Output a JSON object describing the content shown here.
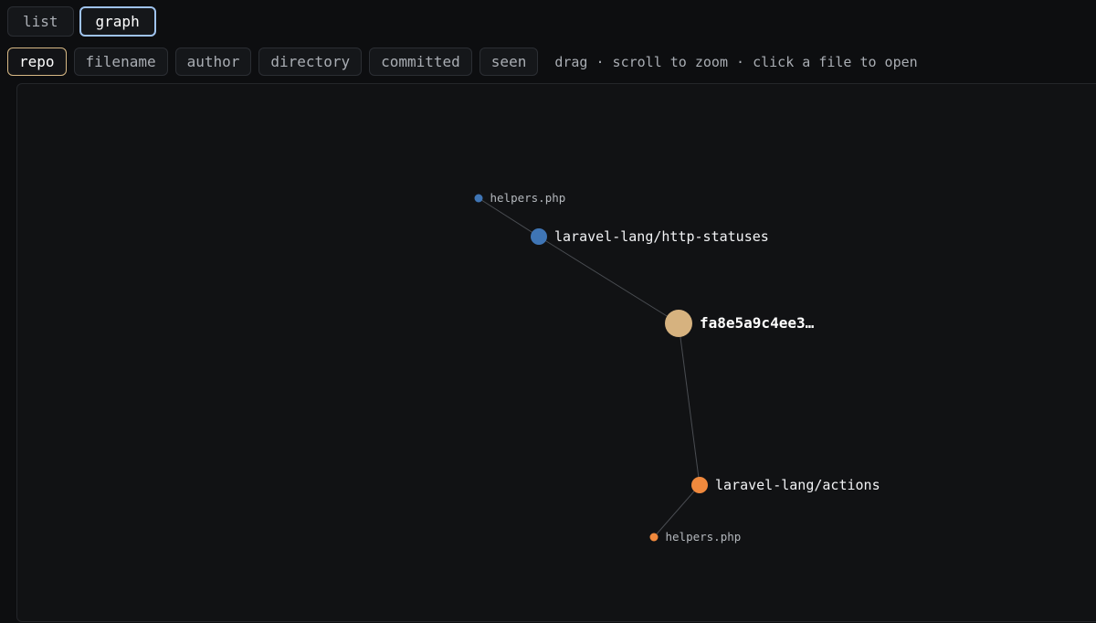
{
  "view_tabs": [
    {
      "label": "list",
      "active": false
    },
    {
      "label": "graph",
      "active": true
    }
  ],
  "group_tabs": [
    {
      "label": "repo",
      "active": true
    },
    {
      "label": "filename",
      "active": false
    },
    {
      "label": "author",
      "active": false
    },
    {
      "label": "directory",
      "active": false
    },
    {
      "label": "committed",
      "active": false
    },
    {
      "label": "seen",
      "active": false
    }
  ],
  "hint": "drag · scroll to zoom · click a file to open",
  "colors": {
    "background": "#0d0e10",
    "panel": "#111214",
    "edge": "#4a4d52",
    "root": "#d6b27f",
    "repo_blue": "#3f75b5",
    "repo_orange": "#f0893d"
  },
  "graph": {
    "nodes": [
      {
        "id": "root",
        "label": "fa8e5a9c4ee3…",
        "kind": "root"
      },
      {
        "id": "repo-http",
        "label": "laravel-lang/http-statuses",
        "kind": "repo",
        "color": "#3f75b5"
      },
      {
        "id": "file-http-helpers",
        "label": "helpers.php",
        "kind": "file",
        "color": "#3f75b5"
      },
      {
        "id": "repo-actions",
        "label": "laravel-lang/actions",
        "kind": "repo",
        "color": "#f0893d"
      },
      {
        "id": "file-actions-helpers",
        "label": "helpers.php",
        "kind": "file",
        "color": "#f0893d"
      }
    ],
    "edges": [
      {
        "source": "root",
        "target": "repo-http"
      },
      {
        "source": "repo-http",
        "target": "file-http-helpers"
      },
      {
        "source": "root",
        "target": "repo-actions"
      },
      {
        "source": "repo-actions",
        "target": "file-actions-helpers"
      }
    ]
  }
}
